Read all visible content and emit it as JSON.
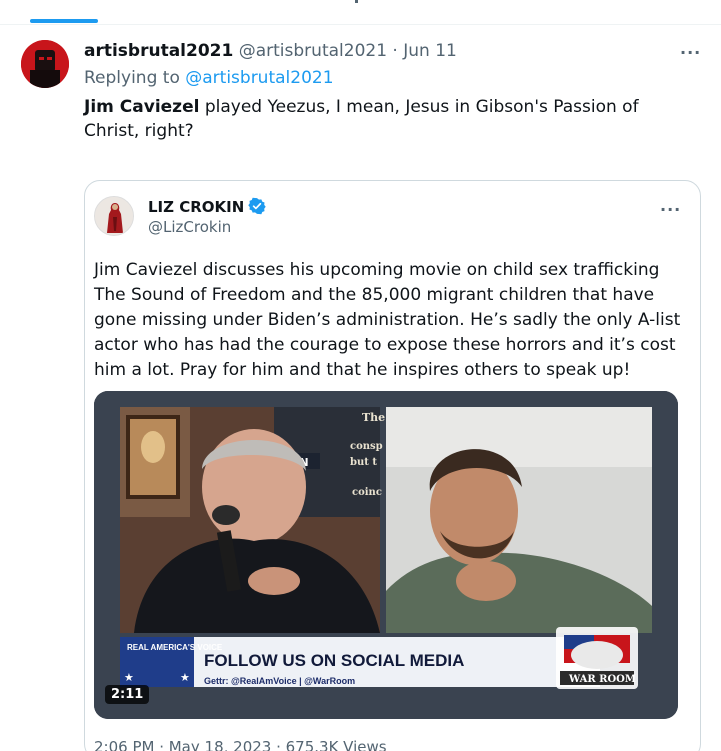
{
  "main_tweet": {
    "author_name": "artisbrutal2021",
    "author_handle": "@artisbrutal2021",
    "separator": "·",
    "date": "Jun 11",
    "more_label": "···",
    "replying_prefix": "Replying to",
    "replying_handle": "@artisbrutal2021",
    "text_bold": "Jim Caviezel",
    "text_rest": " played Yeezus, I mean, Jesus in Gibson's Passion of Christ, right?"
  },
  "quote_tweet": {
    "author_name": "LIZ CROKIN",
    "author_handle": "@LizCrokin",
    "more_label": "···",
    "text": "Jim Caviezel discusses his upcoming movie on child sex trafficking The Sound of Freedom and the 85,000 migrant children that have gone missing under Biden’s administration. He’s sadly the only A-list actor who has had the courage to expose these horrors and it’s cost him a lot. Pray for him and that he inspires others to speak up!",
    "video": {
      "duration": "2:11",
      "lower_third_logo": "REAL AMERICA'S VOICE",
      "banner_headline": "FOLLOW US ON SOCIAL MEDIA",
      "banner_sub": "Gettr: @RealAmVoice | @WarRoom",
      "war_room_label": "WAR ROOM",
      "background_sign_words": [
        "The",
        "consp",
        "but t",
        "coinc",
        "ON"
      ]
    },
    "footer_partial": "2:06 PM · May 18, 2023 · 675.3K Views"
  },
  "colors": {
    "accent": "#1d9bf0",
    "text_primary": "#0f1419",
    "text_secondary": "#536471",
    "border": "#cfd9de"
  }
}
